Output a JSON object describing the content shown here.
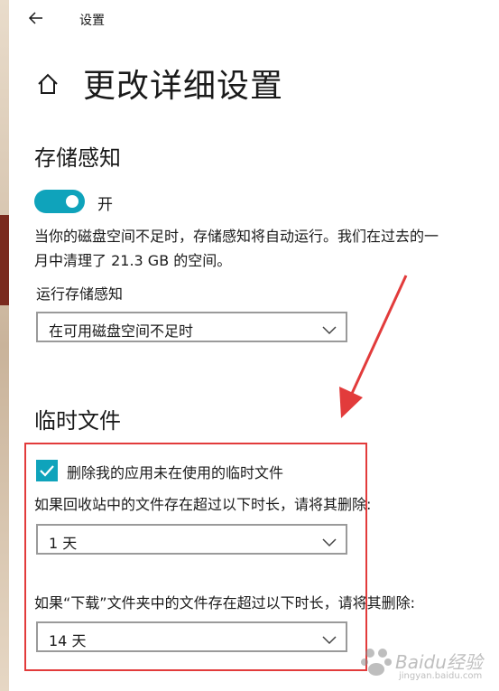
{
  "titlebar": {
    "title": "设置"
  },
  "page": {
    "title": "更改详细设置"
  },
  "storage_sense": {
    "title": "存储感知",
    "toggle_state": "开",
    "description_line1": "当你的磁盘空间不足时，存储感知将自动运行。我们在过去的一",
    "description_line2": "月中清理了 21.3 GB 的空间。",
    "run_label": "运行存储感知",
    "run_value": "在可用磁盘空间不足时"
  },
  "temp_files": {
    "title": "临时文件",
    "checkbox_label": "删除我的应用未在使用的临时文件",
    "recycle_label": "如果回收站中的文件存在超过以下时长，请将其删除:",
    "recycle_value": "1 天",
    "downloads_label": "如果“下载”文件夹中的文件存在超过以下时长，请将其删除:",
    "downloads_value": "14 天"
  },
  "watermark": {
    "text": "Baidu经验",
    "url": "jingyan.baidu.com"
  },
  "colors": {
    "accent": "#0fa3bb",
    "highlight": "#e23b3b"
  },
  "icons": {
    "back": "back-arrow-icon",
    "home": "home-icon",
    "chevron": "chevron-down-icon",
    "check": "checkmark-icon",
    "annotation": "red-arrow-icon"
  }
}
